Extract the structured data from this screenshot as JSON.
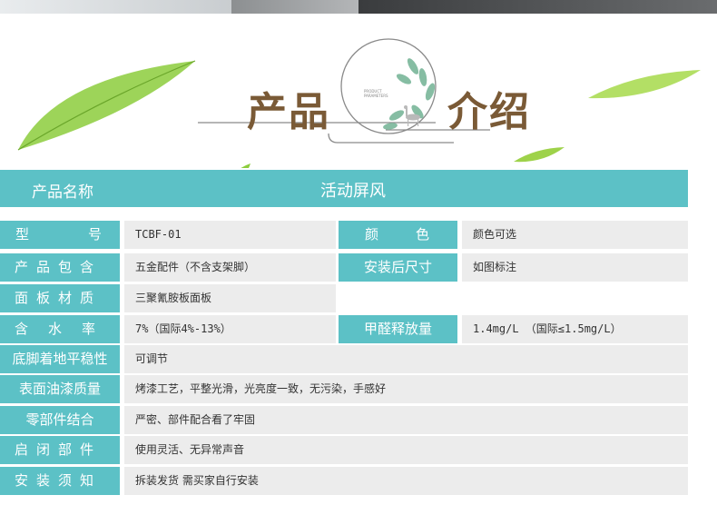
{
  "banner": {
    "title_left": "产品",
    "title_right": "介绍",
    "deco_text": "PRODUCT PARAMETERS"
  },
  "product": {
    "label": "产品名称",
    "value": "活动屏风"
  },
  "rows": {
    "model_label": "型号",
    "model_label_a": "型",
    "model_label_b": "号",
    "model_value": "TCBF-01",
    "color_label_a": "颜",
    "color_label_b": "色",
    "color_value": "颜色可选",
    "package_label": "产品包含",
    "package_value": "五金配件（不含支架脚）",
    "size_label": "安装后尺寸",
    "size_value": "如图标注",
    "board_label": "面板材质",
    "board_value": "三聚氰胺板面板",
    "moisture_label": "含水率",
    "moisture_value": "7%（国际4%-13%）",
    "formaldehyde_label": "甲醛释放量",
    "formaldehyde_value": "1.4mg/L （国际≤1.5mg/L）",
    "foot_label": "底脚着地平稳性",
    "foot_value": "可调节",
    "paint_label": "表面油漆质量",
    "paint_value": "烤漆工艺，平整光滑，光亮度一致，无污染，手感好",
    "parts_label": "零部件结合",
    "parts_value": "严密、部件配合看了牢固",
    "open_label": "启闭部件",
    "open_value": "使用灵活、无异常声音",
    "install_label": "安装须知",
    "install_value": "拆装发货 需买家自行安装"
  }
}
